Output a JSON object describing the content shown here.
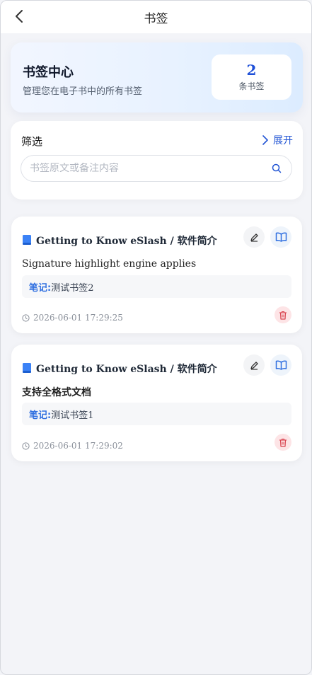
{
  "header": {
    "title": "书签"
  },
  "hero": {
    "title": "书签中心",
    "subtitle": "管理您在电子书中的所有书签",
    "count": "2",
    "count_label": "条书签"
  },
  "filter": {
    "title": "筛选",
    "expand_label": "展开",
    "search_placeholder": "书签原文或备注内容"
  },
  "bookmarks": [
    {
      "book_title": "Getting to Know eSlash / 软件简介",
      "excerpt": "Signature highlight engine applies",
      "note_label": "笔记:",
      "note_text": "测试书签2",
      "time": "2026-06-01 17:29:25"
    },
    {
      "book_title": "Getting to Know eSlash / 软件简介",
      "excerpt": "支持全格式文档",
      "note_label": "笔记:",
      "note_text": "测试书签1",
      "time": "2026-06-01 17:29:02"
    }
  ],
  "colors": {
    "accent": "#2f6fe0",
    "danger": "#d9434f",
    "danger_bg": "#fde4e6"
  }
}
